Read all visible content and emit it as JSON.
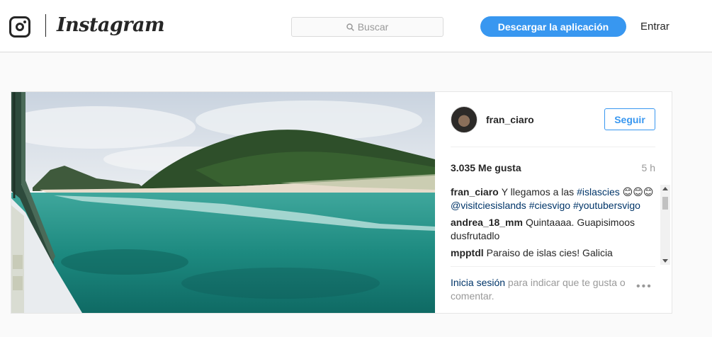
{
  "header": {
    "logo_icon": "instagram-camera-icon",
    "wordmark": "Instagram",
    "search_placeholder": "Buscar",
    "download_button": "Descargar la aplicación",
    "login_link": "Entrar"
  },
  "post": {
    "photo_description_icon": "beach-photo",
    "author": "fran_ciaro",
    "follow_button": "Seguir",
    "likes": "3.035 Me gusta",
    "time_ago": "5 h",
    "comments": [
      {
        "user": "fran_ciaro",
        "parts": [
          {
            "t": "Y llegamos a las ",
            "tag": false
          },
          {
            "t": "#islascies",
            "tag": true
          },
          {
            "t": " 😊😊😊 ",
            "tag": false
          },
          {
            "t": "@visitciesislands",
            "tag": true
          },
          {
            "t": " ",
            "tag": false
          },
          {
            "t": "#ciesvigo",
            "tag": true
          },
          {
            "t": " ",
            "tag": false
          },
          {
            "t": "#youtubersvigo",
            "tag": true
          }
        ]
      },
      {
        "user": "andrea_18_mm",
        "parts": [
          {
            "t": "Quintaaaa. Guapisimoos dusfrutadlo",
            "tag": false
          }
        ]
      },
      {
        "user": "mpptdl",
        "parts": [
          {
            "t": "Paraiso de islas cies! Galicia",
            "tag": false
          }
        ]
      }
    ],
    "login_prompt_link": "Inicia sesión",
    "login_prompt_rest": " para indicar que te gusta o comentar.",
    "more_options": "•••"
  },
  "colors": {
    "accent": "#3897f0",
    "link_dark": "#003569",
    "muted": "#999999"
  }
}
